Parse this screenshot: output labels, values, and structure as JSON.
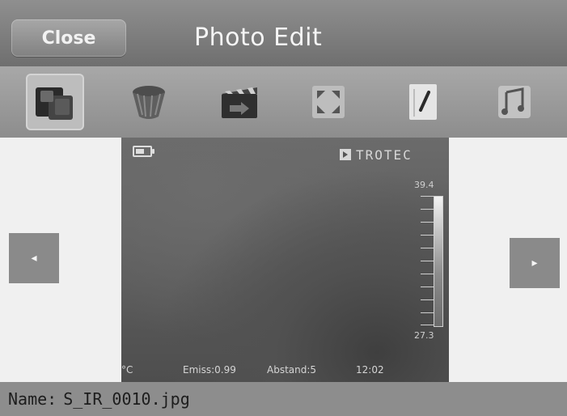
{
  "header": {
    "close_label": "Close",
    "title": "Photo Edit"
  },
  "toolbar": {
    "items": [
      {
        "name": "gallery",
        "selected": true,
        "icon": "photo-gallery-icon"
      },
      {
        "name": "delete",
        "selected": false,
        "icon": "trash-bin-icon"
      },
      {
        "name": "slideshow",
        "selected": false,
        "icon": "clapperboard-icon"
      },
      {
        "name": "fullscreen",
        "selected": false,
        "icon": "fullscreen-icon"
      },
      {
        "name": "annotate",
        "selected": false,
        "icon": "pen-icon"
      },
      {
        "name": "audio",
        "selected": false,
        "icon": "music-note-icon"
      }
    ]
  },
  "viewer": {
    "prev_arrow": "◂",
    "next_arrow": "▸",
    "brand": "TROTEC",
    "scale_max": "39.4",
    "scale_min": "27.3",
    "unit": "°C",
    "emiss": "Emiss:0.99",
    "abstand": "Abstand:5",
    "time": "12:02"
  },
  "footer": {
    "name_label": "Name:",
    "file_name": "S_IR_0010.jpg"
  }
}
